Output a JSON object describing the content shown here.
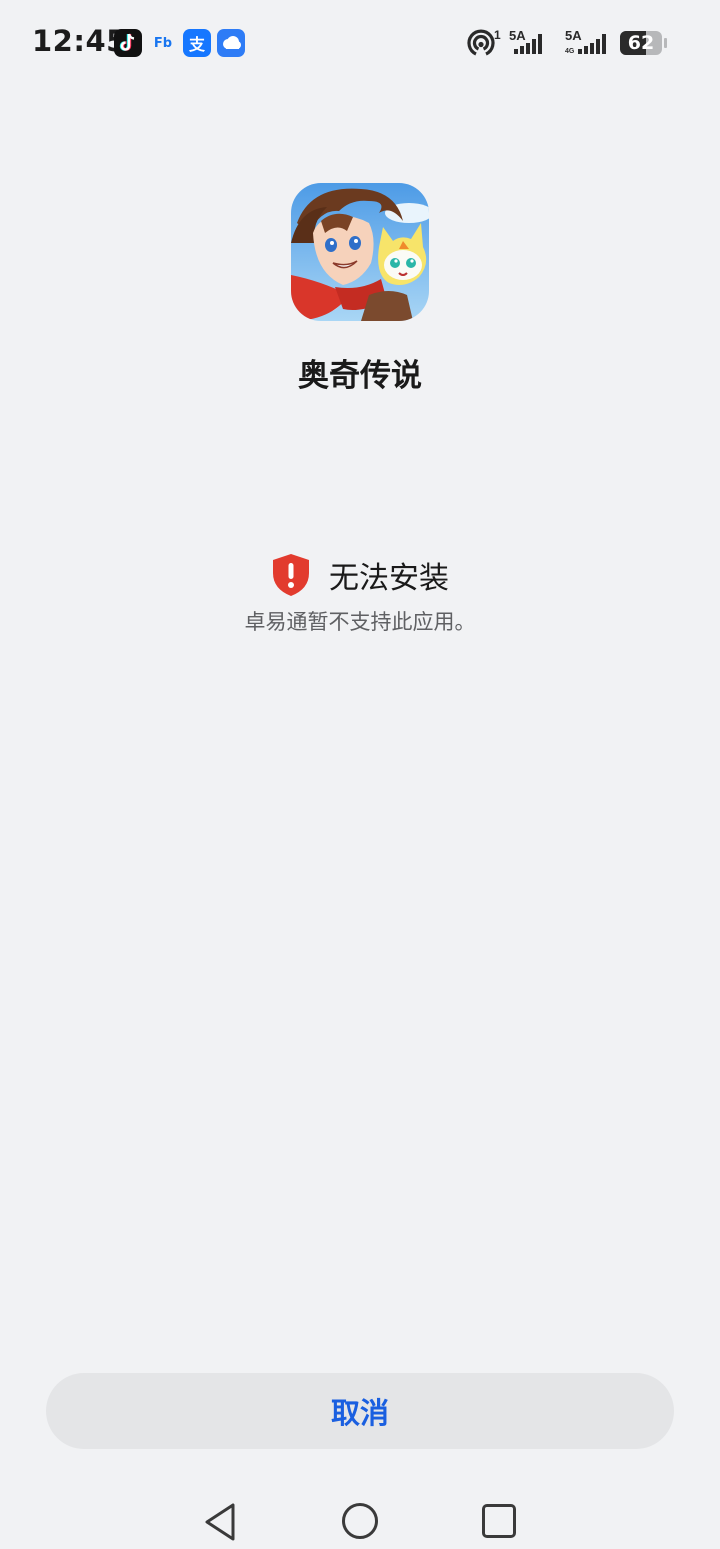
{
  "status_bar": {
    "time": "12:45",
    "notifications": [
      {
        "name": "tiktok-icon",
        "glyph": "♪"
      },
      {
        "name": "fb-icon",
        "glyph": "Fb"
      },
      {
        "name": "alipay-icon",
        "glyph": "支"
      },
      {
        "name": "weather-icon",
        "glyph": ""
      }
    ],
    "hotspot_count": "1",
    "signal_1_label": "5A",
    "signal_2_label": "5A",
    "battery_level": "62",
    "battery_fraction": 0.62
  },
  "app": {
    "name": "奥奇传说",
    "icon": "game-character-app-icon"
  },
  "message": {
    "title": "无法安装",
    "description": "卓易通暂不支持此应用。",
    "icon": "shield-warning-icon",
    "accent_color": "#e23b2e"
  },
  "actions": {
    "cancel_label": "取消",
    "cancel_color": "#1a5fe0"
  },
  "nav": {
    "back": "back-triangle-icon",
    "home": "home-circle-icon",
    "recent": "recent-square-icon"
  }
}
